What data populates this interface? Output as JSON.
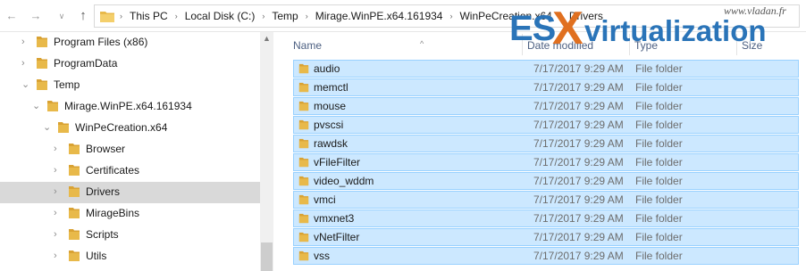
{
  "nav_buttons": {
    "back": "←",
    "forward": "→",
    "recent": "∨",
    "up": "↑"
  },
  "address_bar": {
    "crumbs": [
      "This PC",
      "Local Disk (C:)",
      "Temp",
      "Mirage.WinPE.x64.161934",
      "WinPeCreation.x64",
      "Drivers"
    ]
  },
  "tree": [
    {
      "label": "Program Files (x86)",
      "expanded": false,
      "depth": 0
    },
    {
      "label": "ProgramData",
      "expanded": false,
      "depth": 0
    },
    {
      "label": "Temp",
      "expanded": true,
      "depth": 0
    },
    {
      "label": "Mirage.WinPE.x64.161934",
      "expanded": true,
      "depth": 1
    },
    {
      "label": "WinPeCreation.x64",
      "expanded": true,
      "depth": 2
    },
    {
      "label": "Browser",
      "expanded": false,
      "depth": 3
    },
    {
      "label": "Certificates",
      "expanded": false,
      "depth": 3
    },
    {
      "label": "Drivers",
      "expanded": false,
      "depth": 3,
      "selected": true
    },
    {
      "label": "MirageBins",
      "expanded": false,
      "depth": 3
    },
    {
      "label": "Scripts",
      "expanded": false,
      "depth": 3
    },
    {
      "label": "Utils",
      "expanded": false,
      "depth": 3
    }
  ],
  "columns": {
    "name": "Name",
    "date": "Date modified",
    "type": "Type",
    "size": "Size"
  },
  "files": [
    {
      "name": "audio",
      "date": "7/17/2017 9:29 AM",
      "type": "File folder"
    },
    {
      "name": "memctl",
      "date": "7/17/2017 9:29 AM",
      "type": "File folder"
    },
    {
      "name": "mouse",
      "date": "7/17/2017 9:29 AM",
      "type": "File folder"
    },
    {
      "name": "pvscsi",
      "date": "7/17/2017 9:29 AM",
      "type": "File folder"
    },
    {
      "name": "rawdsk",
      "date": "7/17/2017 9:29 AM",
      "type": "File folder"
    },
    {
      "name": "vFileFilter",
      "date": "7/17/2017 9:29 AM",
      "type": "File folder"
    },
    {
      "name": "video_wddm",
      "date": "7/17/2017 9:29 AM",
      "type": "File folder"
    },
    {
      "name": "vmci",
      "date": "7/17/2017 9:29 AM",
      "type": "File folder"
    },
    {
      "name": "vmxnet3",
      "date": "7/17/2017 9:29 AM",
      "type": "File folder"
    },
    {
      "name": "vNetFilter",
      "date": "7/17/2017 9:29 AM",
      "type": "File folder"
    },
    {
      "name": "vss",
      "date": "7/17/2017 9:29 AM",
      "type": "File folder"
    }
  ],
  "watermark": {
    "url": "www.vladan.fr",
    "es": "ES",
    "x": "X",
    "brand": "virtualization"
  },
  "colors": {
    "folder": "#e8b94a",
    "folder_dark": "#d9a233",
    "selection_fill": "#cce8ff",
    "selection_border": "#99d1ff",
    "tree_selected": "#d9d9d9",
    "logo_blue": "#2a74b8",
    "logo_orange": "#e07020"
  }
}
